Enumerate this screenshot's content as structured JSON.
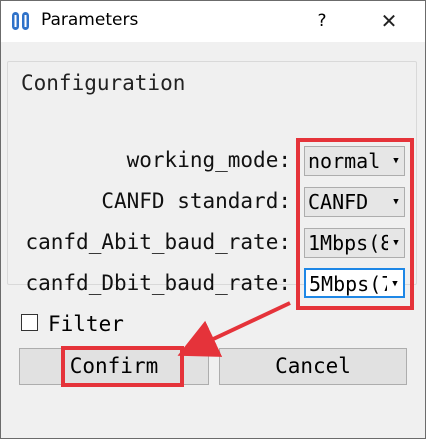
{
  "window": {
    "title": "Parameters",
    "help_label": "?",
    "close_label": "✕"
  },
  "group": {
    "title": "Configuration"
  },
  "fields": [
    {
      "label": "working_mode:",
      "value": "normal"
    },
    {
      "label": "CANFD standard:",
      "value": "CANFD"
    },
    {
      "label": "canfd_Abit_baud_rate:",
      "value": "1Mbps(8"
    },
    {
      "label": "canfd_Dbit_baud_rate:",
      "value": "5Mbps(7"
    }
  ],
  "filter": {
    "label": "Filter",
    "checked": false
  },
  "buttons": {
    "confirm": "Confirm",
    "cancel": "Cancel"
  },
  "icons": {
    "app": "app-logo-icon",
    "dropdown": "chevron-down-icon",
    "arrow": "annotation-arrow"
  },
  "colors": {
    "annotation": "#e5333a",
    "focus": "#1e87e6",
    "app_icon": "#2f72c9"
  }
}
